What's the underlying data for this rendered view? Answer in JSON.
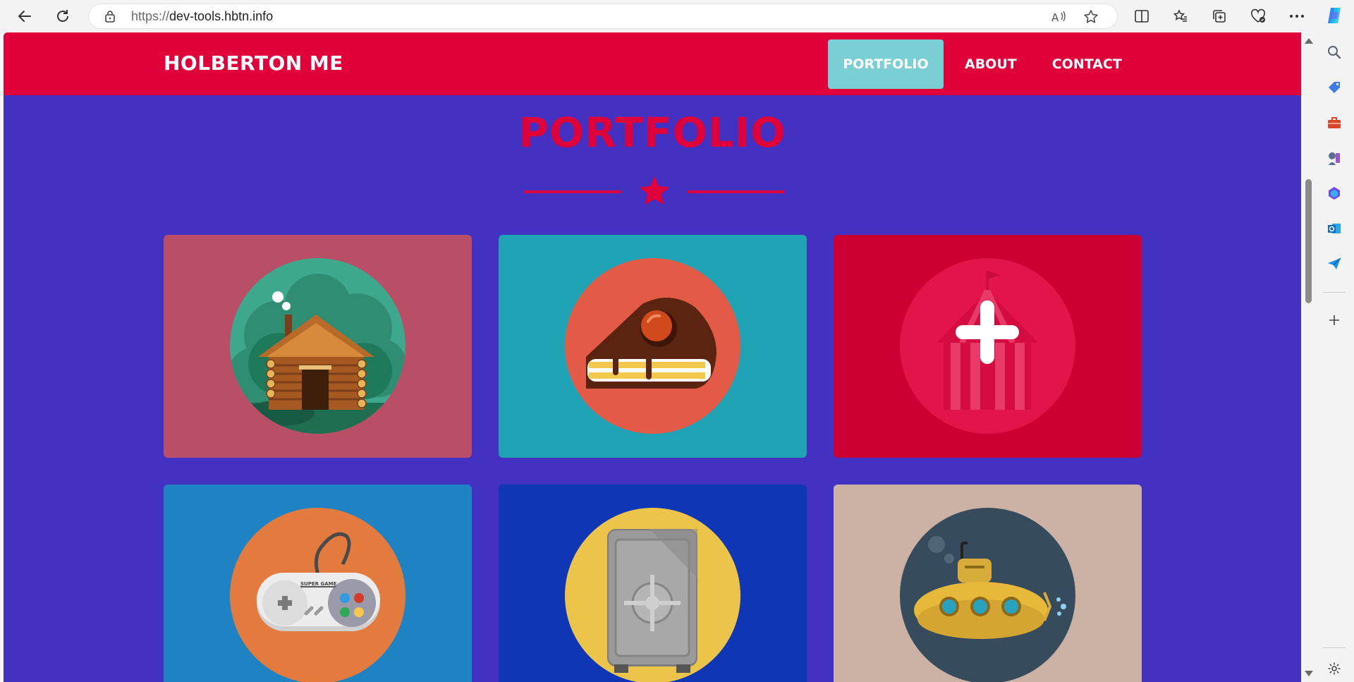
{
  "browser": {
    "url_scheme": "https://",
    "url_host": "dev-tools.hbtn.info"
  },
  "site": {
    "brand": "HOLBERTON ME",
    "nav": [
      {
        "label": "PORTFOLIO",
        "active": true
      },
      {
        "label": "ABOUT",
        "active": false
      },
      {
        "label": "CONTACT",
        "active": false
      }
    ],
    "section_title": "PORTFOLIO"
  },
  "colors": {
    "page_bg": "#4331c1",
    "header_bg": "#e0003a",
    "nav_active_bg": "#7acfd5",
    "accent": "#e0003a"
  },
  "portfolio": [
    {
      "name": "cabin",
      "card_color": "#b94f66",
      "circle_color": "#3d9b83",
      "overlay": false
    },
    {
      "name": "cake",
      "card_color": "#21a3b6",
      "circle_color": "#e35b47",
      "overlay": false
    },
    {
      "name": "circus",
      "card_color": "#cc0033",
      "circle_color": "#e3144a",
      "overlay": true,
      "overlay_icon": "plus-icon"
    },
    {
      "name": "game-controller",
      "card_color": "#1f82c2",
      "circle_color": "#e37b3f",
      "overlay": false
    },
    {
      "name": "safe",
      "card_color": "#0f36b5",
      "circle_color": "#edc44a",
      "overlay": false
    },
    {
      "name": "submarine",
      "card_color": "#cbb2a5",
      "circle_color": "#364c5c",
      "overlay": false
    }
  ]
}
